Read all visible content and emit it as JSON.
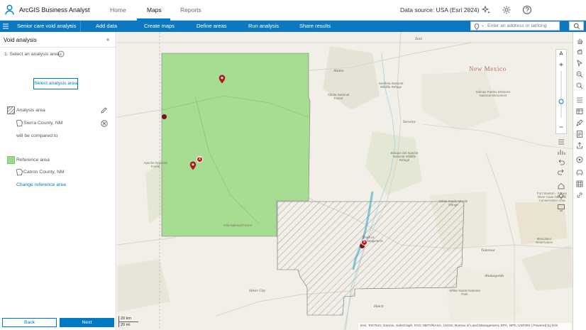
{
  "header": {
    "app_title": "ArcGIS Business Analyst",
    "tabs": [
      {
        "label": "Home",
        "active": false
      },
      {
        "label": "Maps",
        "active": true
      },
      {
        "label": "Reports",
        "active": false
      }
    ],
    "data_source": "Data source: USA (Esri 2024)"
  },
  "toolbar": {
    "project_name": "Senior care void analysis",
    "items": [
      "Add data",
      "Create maps",
      "Define areas",
      "Run analysis",
      "Share results"
    ],
    "search_placeholder": "Enter an address or lat/long"
  },
  "panel": {
    "title": "Void analysis",
    "step_label": "1.  Select an analysis area.",
    "select_button": "Select analysis area",
    "analysis_area_label": "Analysis area",
    "analysis_area_value": "Sierra County, NM",
    "compared_text": "will be compared to",
    "reference_area_label": "Reference area",
    "reference_area_value": "Catron County, NM",
    "change_link": "Change reference area",
    "back_button": "Back",
    "next_button": "Next"
  },
  "map": {
    "state_label": "New Mexico",
    "place_labels": [
      {
        "text": "Zuni",
        "size": 5.5
      },
      {
        "text": "Alamo",
        "size": 5.5
      },
      {
        "text": "Socorro",
        "size": 5.5
      },
      {
        "text": "Tularosa",
        "size": 5.5
      },
      {
        "text": "Alamogordo",
        "size": 5.5
      },
      {
        "text": "Silver City",
        "size": 5.5
      },
      {
        "text": "Hatch",
        "size": 5.5
      },
      {
        "text": "Truth or Consequences",
        "size": 5
      }
    ],
    "park_labels": [
      "Cibola National Forest",
      "Sevilleta National Wildlife Refuge",
      "Salinas Pueblo Missions National Monument",
      "Bosque del Apache National Wildlife Refuge",
      "Apache National Forest",
      "Gila National Forest",
      "White Sands Missile Range",
      "Fort Stanton - Snowy River Cave National Conservation Area",
      "Mescalero Reservation",
      "White Sands National Park"
    ],
    "marker_badges": [
      "2",
      "5"
    ],
    "scale": {
      "km": "20 km",
      "mi": "20 mi"
    },
    "attribution": "Esri, TomTom, Garmin, SafeGraph, FAO, METI/NASA, USGS, Bureau of Land Management, EPA, NPS, USFWS | Powered by Esri"
  },
  "colors": {
    "accent": "#007ac2",
    "reference_fill": "#9fd98a",
    "marker": "#b3161d",
    "map_background": "#f2efe9"
  }
}
